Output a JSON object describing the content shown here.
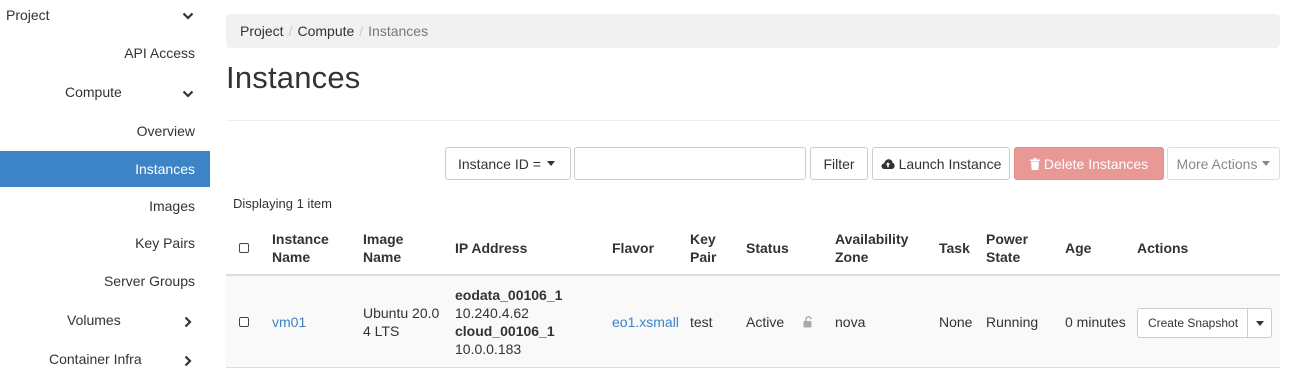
{
  "sidebar": {
    "project": "Project",
    "api_access": "API Access",
    "compute": "Compute",
    "overview": "Overview",
    "instances": "Instances",
    "images": "Images",
    "key_pairs": "Key Pairs",
    "server_groups": "Server Groups",
    "volumes": "Volumes",
    "container_infra": "Container Infra",
    "active_color": "#3c84c6"
  },
  "breadcrumb": {
    "items": [
      "Project",
      "Compute",
      "Instances"
    ],
    "separator": "/"
  },
  "page": {
    "title": "Instances"
  },
  "toolbar": {
    "filter_field": "Instance ID =",
    "filter_value": "",
    "filter_label": "Filter",
    "launch_label": "Launch Instance",
    "delete_label": "Delete Instances",
    "more_label": "More Actions",
    "delete_color": "#e89895"
  },
  "table": {
    "displaying": "Displaying 1 item",
    "headers": {
      "instance_name": [
        "Instance",
        "Name"
      ],
      "image_name": [
        "Image",
        "Name"
      ],
      "ip_address": "IP Address",
      "flavor": "Flavor",
      "key_pair": [
        "Key",
        "Pair"
      ],
      "status": "Status",
      "availability_zone": [
        "Availability",
        "Zone"
      ],
      "task": "Task",
      "power_state": [
        "Power",
        "State"
      ],
      "age": "Age",
      "actions": "Actions"
    },
    "rows": [
      {
        "instance_name": "vm01",
        "image_name": [
          "Ubuntu 20.0",
          "4 LTS"
        ],
        "ip": {
          "net1_name": "eodata_00106_1",
          "net1_ip": "10.240.4.62",
          "net2_name": "cloud_00106_1",
          "net2_ip": "10.0.0.183"
        },
        "flavor": "eo1.xsmall",
        "key_pair": "test",
        "status": "Active",
        "availability_zone": "nova",
        "task": "None",
        "power_state": "Running",
        "age": "0 minutes",
        "action_label": "Create Snapshot"
      }
    ]
  },
  "icons": {
    "chevron": "chevron-icon",
    "cloud_upload": "cloud-upload-icon",
    "trash": "trash-icon",
    "lock": "unlock-icon"
  }
}
